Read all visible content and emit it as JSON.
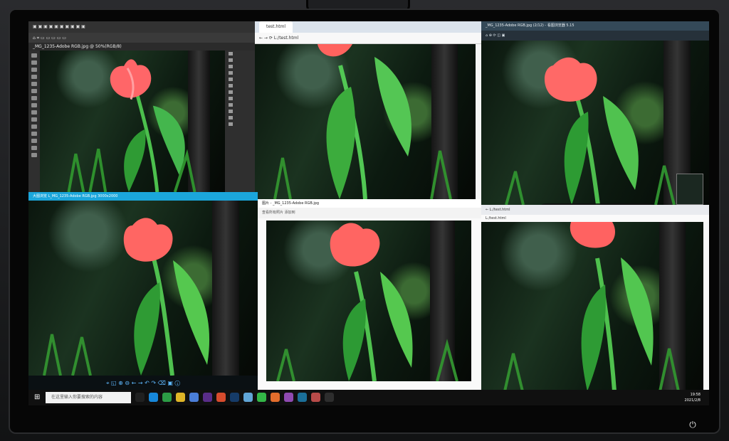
{
  "screen": {
    "ps_tab": "_MG_1235-Adobe RGB.jpg @ 50%(RGB/8)",
    "browser_url": "L:/test.html",
    "browser_tab": "test.html",
    "photo_viewer_title": "_MG_1235-Adobe RGB.jpg (2/12) - 看图浏览器 5.15",
    "photos_title": "图片 - _MG_1235-Adobe RGB.jpg",
    "photos_cmd": "查看所有照片     添加到",
    "lower_left_title": "大图浏览 L_MG_1235-Adobe RGB.jpg 3000x2000",
    "mini_browser_tab": "L:/test.html",
    "mini_browser_fav": "L:/test.html",
    "taskbar_search": "在这里输入你要搜索的内容",
    "clock_time": "19:58",
    "clock_date": "2021/2/8",
    "colors": {
      "accent": "#1ba6db",
      "tulip": "#ff5e5a",
      "leaf": "#36b83b"
    }
  }
}
